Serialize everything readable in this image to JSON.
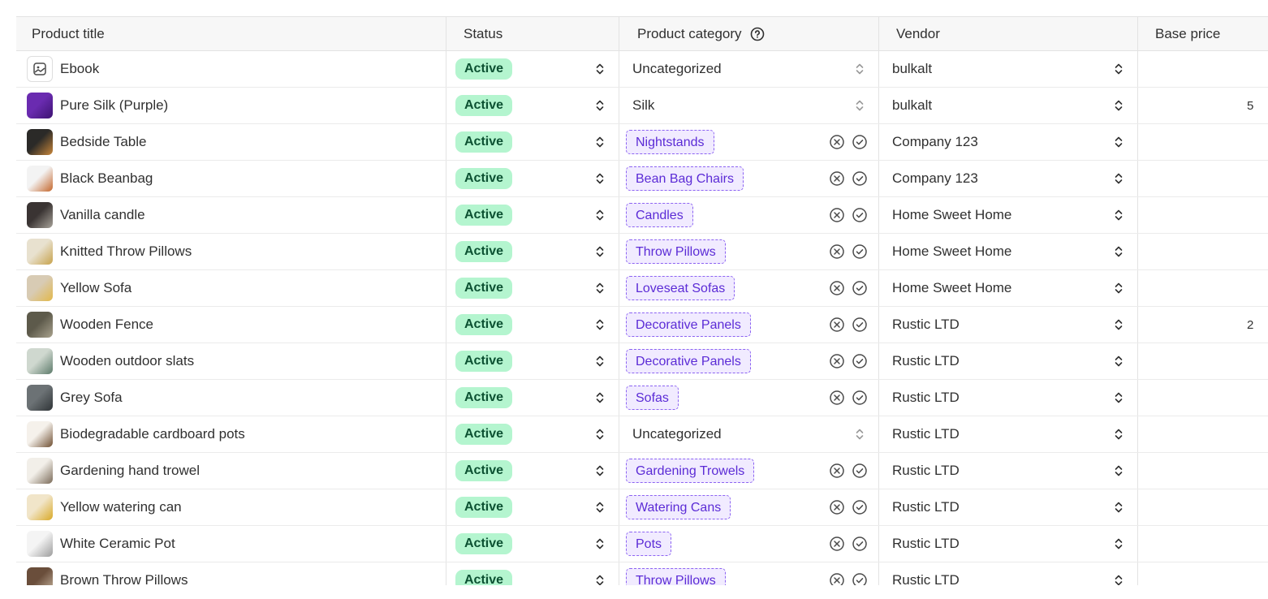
{
  "columns": {
    "product_title": "Product title",
    "status": "Status",
    "product_category": "Product category",
    "vendor": "Vendor",
    "base_price": "Base price"
  },
  "rows": [
    {
      "title": "Ebook",
      "thumb": "ebook-icon",
      "status": "Active",
      "category": "Uncategorized",
      "category_suggested": false,
      "vendor": "bulkalt",
      "price_partial": ""
    },
    {
      "title": "Pure Silk (Purple)",
      "thumb": "purple-silk",
      "status": "Active",
      "category": "Silk",
      "category_suggested": false,
      "vendor": "bulkalt",
      "price_partial": "5"
    },
    {
      "title": "Bedside Table",
      "thumb": "bedside-table",
      "status": "Active",
      "category": "Nightstands",
      "category_suggested": true,
      "vendor": "Company 123",
      "price_partial": ""
    },
    {
      "title": "Black Beanbag",
      "thumb": "black-beanbag",
      "status": "Active",
      "category": "Bean Bag Chairs",
      "category_suggested": true,
      "vendor": "Company 123",
      "price_partial": ""
    },
    {
      "title": "Vanilla candle",
      "thumb": "vanilla-candle",
      "status": "Active",
      "category": "Candles",
      "category_suggested": true,
      "vendor": "Home Sweet Home",
      "price_partial": ""
    },
    {
      "title": "Knitted Throw Pillows",
      "thumb": "knitted-pillows",
      "status": "Active",
      "category": "Throw Pillows",
      "category_suggested": true,
      "vendor": "Home Sweet Home",
      "price_partial": ""
    },
    {
      "title": "Yellow Sofa",
      "thumb": "yellow-sofa",
      "status": "Active",
      "category": "Loveseat Sofas",
      "category_suggested": true,
      "vendor": "Home Sweet Home",
      "price_partial": ""
    },
    {
      "title": "Wooden Fence",
      "thumb": "wooden-fence",
      "status": "Active",
      "category": "Decorative Panels",
      "category_suggested": true,
      "vendor": "Rustic LTD",
      "price_partial": "2"
    },
    {
      "title": "Wooden outdoor slats",
      "thumb": "outdoor-slats",
      "status": "Active",
      "category": "Decorative Panels",
      "category_suggested": true,
      "vendor": "Rustic LTD",
      "price_partial": ""
    },
    {
      "title": "Grey Sofa",
      "thumb": "grey-sofa",
      "status": "Active",
      "category": "Sofas",
      "category_suggested": true,
      "vendor": "Rustic LTD",
      "price_partial": ""
    },
    {
      "title": "Biodegradable cardboard pots",
      "thumb": "cardboard-pots",
      "status": "Active",
      "category": "Uncategorized",
      "category_suggested": false,
      "vendor": "Rustic LTD",
      "price_partial": ""
    },
    {
      "title": "Gardening hand trowel",
      "thumb": "hand-trowel",
      "status": "Active",
      "category": "Gardening Trowels",
      "category_suggested": true,
      "vendor": "Rustic LTD",
      "price_partial": ""
    },
    {
      "title": "Yellow watering can",
      "thumb": "watering-can",
      "status": "Active",
      "category": "Watering Cans",
      "category_suggested": true,
      "vendor": "Rustic LTD",
      "price_partial": ""
    },
    {
      "title": "White Ceramic Pot",
      "thumb": "ceramic-pot",
      "status": "Active",
      "category": "Pots",
      "category_suggested": true,
      "vendor": "Rustic LTD",
      "price_partial": ""
    },
    {
      "title": "Brown Throw Pillows",
      "thumb": "brown-pillows",
      "status": "Active",
      "category": "Throw Pillows",
      "category_suggested": true,
      "vendor": "Rustic LTD",
      "price_partial": ""
    }
  ],
  "thumb_colors": {
    "purple-silk": [
      "#6a2bb0",
      "#3d1372"
    ],
    "bedside-table": [
      "#2b2a28",
      "#c9873a"
    ],
    "black-beanbag": [
      "#f3f3f3",
      "#c4662b"
    ],
    "vanilla-candle": [
      "#3a3433",
      "#a8a39a"
    ],
    "knitted-pillows": [
      "#e8e1cf",
      "#c7a24b"
    ],
    "yellow-sofa": [
      "#d8cbb4",
      "#e2b84a"
    ],
    "wooden-fence": [
      "#5d5a4b",
      "#a9a28e"
    ],
    "outdoor-slats": [
      "#cfd8cf",
      "#5c7a6a"
    ],
    "grey-sofa": [
      "#6c7275",
      "#2f3437"
    ],
    "cardboard-pots": [
      "#f5f1eb",
      "#6f4f32"
    ],
    "hand-trowel": [
      "#f2efe9",
      "#7a6a58"
    ],
    "watering-can": [
      "#f1e5c9",
      "#d9a926"
    ],
    "ceramic-pot": [
      "#f4f4f4",
      "#9c9c9c"
    ],
    "brown-pillows": [
      "#6a4e3b",
      "#c8b6a0"
    ]
  },
  "colors": {
    "status_badge_bg": "#b4f5cf",
    "status_badge_text": "#0c5132",
    "tag_bg": "#f1ebff",
    "tag_border": "#8c63f2",
    "tag_text": "#5b2bd6"
  },
  "icons": {
    "help": "question-circle-icon",
    "select": "chevron-up-down-icon",
    "reject": "x-circle-icon",
    "accept": "check-circle-icon"
  }
}
